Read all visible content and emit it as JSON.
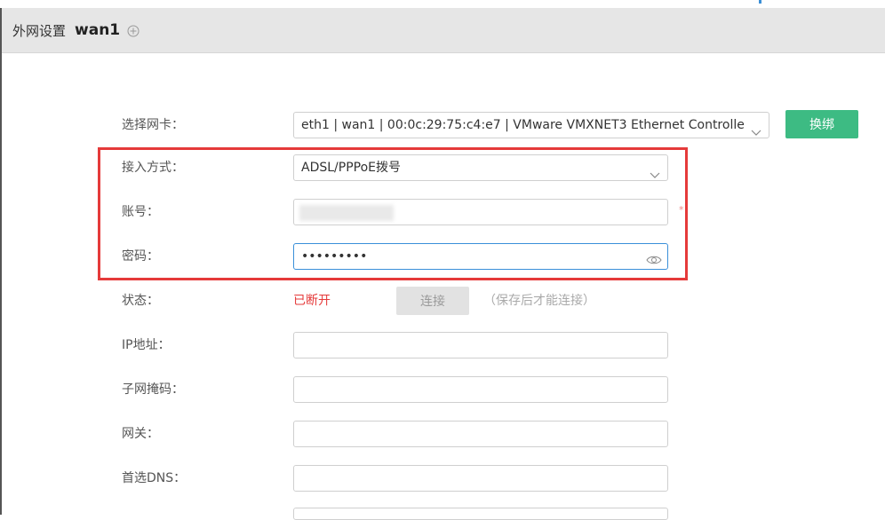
{
  "header": {
    "section_title": "外网设置",
    "interface_name": "wan1"
  },
  "form": {
    "nic": {
      "label": "选择网卡：",
      "value": "eth1 | wan1 | 00:0c:29:75:c4:e7 | VMware VMXNET3 Ethernet Controlle",
      "rebind_label": "换绑"
    },
    "access_mode": {
      "label": "接入方式：",
      "value": "ADSL/PPPoE拨号"
    },
    "account": {
      "label": "账号：",
      "required_mark": "*"
    },
    "password": {
      "label": "密码：",
      "value": "•••••••••"
    },
    "status": {
      "label": "状态：",
      "value": "已断开",
      "connect_label": "连接",
      "hint": "（保存后才能连接）"
    },
    "ip": {
      "label": "IP地址：",
      "value": ""
    },
    "subnet": {
      "label": "子网掩码：",
      "value": ""
    },
    "gateway": {
      "label": "网关：",
      "value": ""
    },
    "dns": {
      "label": "首选DNS：",
      "value": ""
    }
  },
  "colors": {
    "accent_green": "#3dbb83",
    "highlight_red": "#e53a3a",
    "focus_blue": "#3a8fd9"
  }
}
